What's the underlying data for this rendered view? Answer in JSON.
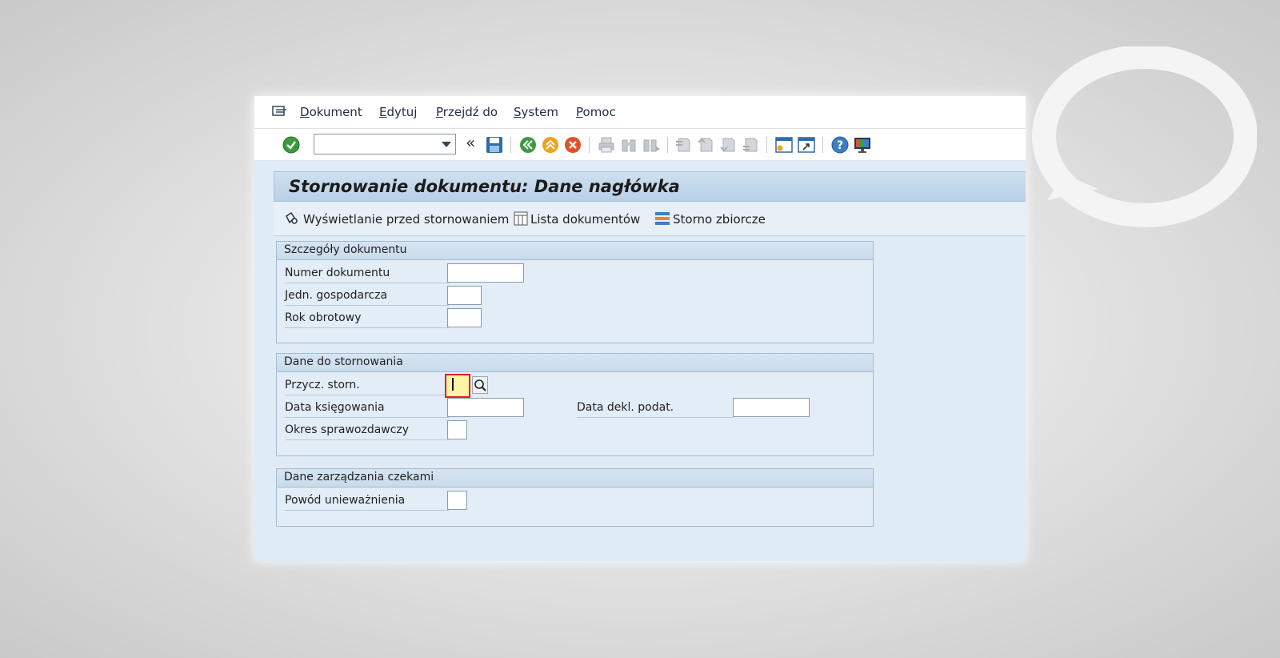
{
  "menubar": {
    "items": [
      {
        "label": "Dokument",
        "accel": "D",
        "rest": "okument"
      },
      {
        "label": "Edytuj",
        "accel": "E",
        "rest": "dytuj"
      },
      {
        "label": "Przejdź do",
        "accel": "P",
        "rest": "rzejdź do"
      },
      {
        "label": "System",
        "accel": "S",
        "rest": "ystem"
      },
      {
        "label": "Pomoc",
        "accel": "P",
        "rest": "omoc"
      }
    ]
  },
  "toolbar": {
    "command_field": {
      "value": ""
    }
  },
  "screen": {
    "title": "Stornowanie dokumentu: Dane nagłówka"
  },
  "app_toolbar": {
    "display_before_reversal": "Wyświetlanie przed stornowaniem",
    "document_list": "Lista dokumentów",
    "mass_reversal": "Storno zbiorcze"
  },
  "groups": {
    "document_details": {
      "title": "Szczegóły dokumentu",
      "document_number": {
        "label": "Numer dokumentu",
        "value": ""
      },
      "company_code": {
        "label": "Jedn. gospodarcza",
        "value": ""
      },
      "fiscal_year": {
        "label": "Rok obrotowy",
        "value": ""
      }
    },
    "reversal_data": {
      "title": "Dane do stornowania",
      "reversal_reason": {
        "label": "Przycz. storn.",
        "value": ""
      },
      "posting_date": {
        "label": "Data księgowania",
        "value": ""
      },
      "tax_report_date": {
        "label": "Data dekl. podat.",
        "value": ""
      },
      "posting_period": {
        "label": "Okres sprawozdawczy",
        "value": ""
      }
    },
    "check_management": {
      "title": "Dane zarządzania czekami",
      "void_reason": {
        "label": "Powód unieważnienia",
        "value": ""
      }
    }
  }
}
